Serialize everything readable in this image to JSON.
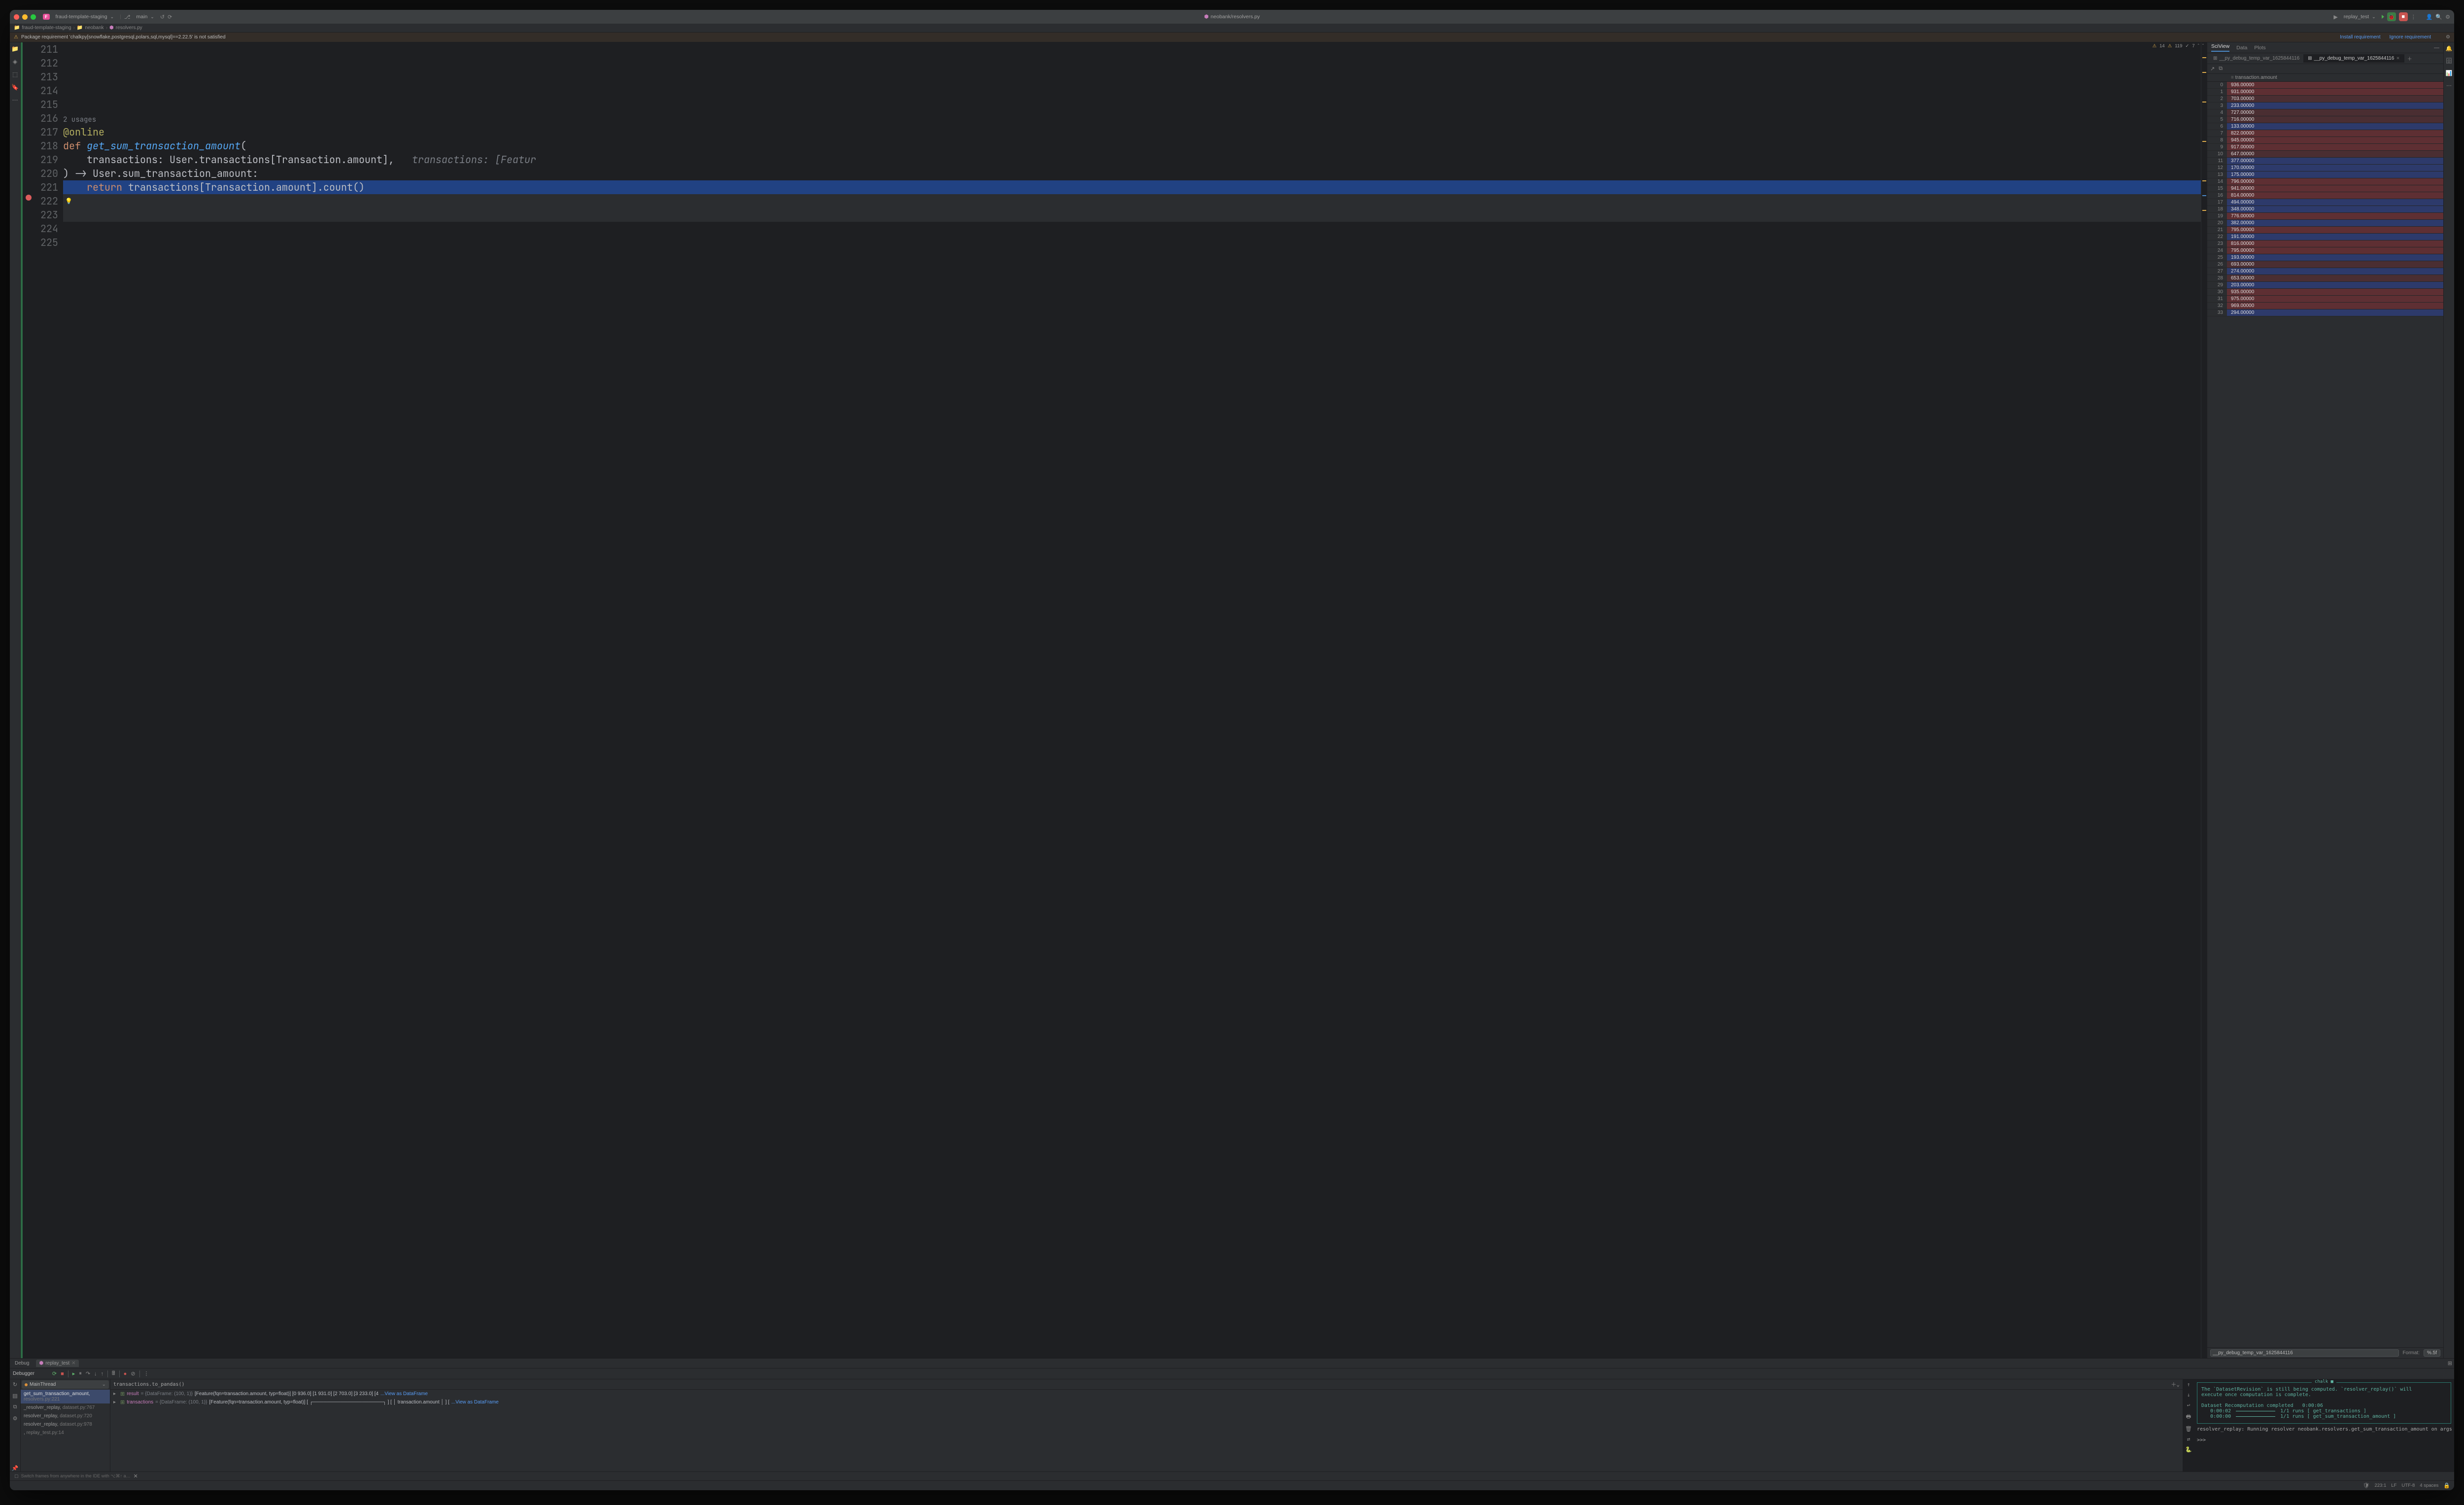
{
  "titlebar": {
    "project_badge": "F",
    "project_name": "fraud-template-staging",
    "branch": "main",
    "center_file": "neobank/resolvers.py",
    "run_config": "replay_test"
  },
  "breadcrumb": {
    "parts": [
      "fraud-template-staging",
      "neobank",
      "resolvers.py"
    ]
  },
  "warning": {
    "text": "Package requirement 'chalkpy[snowflake,postgresql,polars,sql,mysql]==2.22.5' is not satisfied",
    "install": "Install requirement",
    "ignore": "Ignore requirement"
  },
  "editor": {
    "stats": {
      "warn_a": "14",
      "warn_b": "119",
      "typo": "7"
    },
    "lines_start": 211,
    "usages": "2 usages",
    "code": {
      "l217": "@online",
      "l218_def": "def ",
      "l218_fn": "get_sum_transaction_amount",
      "l218_paren": "(",
      "l219": "    transactions: User.transactions[Transaction.amount],",
      "l219_hint": "   transactions: [Featur",
      "l220": ") -> User.sum_transaction_amount:",
      "l221_kw": "    return ",
      "l221_rest": "transactions[Transaction.amount].count()"
    },
    "breakpoint_line": 221
  },
  "sciview": {
    "tabs": [
      "SciView",
      "Data",
      "Plots"
    ],
    "subtabs": [
      "__py_debug_temp_var_1625844116",
      "__py_debug_temp_var_1625844116"
    ],
    "column": "transaction.amount",
    "rows": [
      {
        "i": 0,
        "v": "936.00000",
        "c": "red"
      },
      {
        "i": 1,
        "v": "931.00000",
        "c": "red"
      },
      {
        "i": 2,
        "v": "703.00000",
        "c": "dred"
      },
      {
        "i": 3,
        "v": "233.00000",
        "c": "blue"
      },
      {
        "i": 4,
        "v": "727.00000",
        "c": "dred"
      },
      {
        "i": 5,
        "v": "716.00000",
        "c": "dred"
      },
      {
        "i": 6,
        "v": "133.00000",
        "c": "blue"
      },
      {
        "i": 7,
        "v": "822.00000",
        "c": "red"
      },
      {
        "i": 8,
        "v": "945.00000",
        "c": "red"
      },
      {
        "i": 9,
        "v": "917.00000",
        "c": "red"
      },
      {
        "i": 10,
        "v": "647.00000",
        "c": "dred"
      },
      {
        "i": 11,
        "v": "377.00000",
        "c": "blue"
      },
      {
        "i": 12,
        "v": "170.00000",
        "c": "blue"
      },
      {
        "i": 13,
        "v": "175.00000",
        "c": "blue"
      },
      {
        "i": 14,
        "v": "796.00000",
        "c": "red"
      },
      {
        "i": 15,
        "v": "941.00000",
        "c": "red"
      },
      {
        "i": 16,
        "v": "814.00000",
        "c": "red"
      },
      {
        "i": 17,
        "v": "494.00000",
        "c": "blue"
      },
      {
        "i": 18,
        "v": "348.00000",
        "c": "blue"
      },
      {
        "i": 19,
        "v": "776.00000",
        "c": "red"
      },
      {
        "i": 20,
        "v": "382.00000",
        "c": "blue"
      },
      {
        "i": 21,
        "v": "795.00000",
        "c": "red"
      },
      {
        "i": 22,
        "v": "191.00000",
        "c": "blue"
      },
      {
        "i": 23,
        "v": "816.00000",
        "c": "red"
      },
      {
        "i": 24,
        "v": "795.00000",
        "c": "red"
      },
      {
        "i": 25,
        "v": "193.00000",
        "c": "blue"
      },
      {
        "i": 26,
        "v": "693.00000",
        "c": "dred"
      },
      {
        "i": 27,
        "v": "274.00000",
        "c": "blue"
      },
      {
        "i": 28,
        "v": "653.00000",
        "c": "dred"
      },
      {
        "i": 29,
        "v": "203.00000",
        "c": "blue"
      },
      {
        "i": 30,
        "v": "935.00000",
        "c": "red"
      },
      {
        "i": 31,
        "v": "975.00000",
        "c": "red"
      },
      {
        "i": 32,
        "v": "969.00000",
        "c": "red"
      },
      {
        "i": 33,
        "v": "294.00000",
        "c": "blue"
      }
    ],
    "footer_input": "__py_debug_temp_var_1625844116",
    "format_label": "Format:",
    "format_value": "%.5f"
  },
  "debug": {
    "tab_main": "Debug",
    "tab_config": "replay_test",
    "debugger_label": "Debugger",
    "thread": "MainThread",
    "frames": [
      {
        "fn": "get_sum_transaction_amount",
        "loc": "resolvers.py:221"
      },
      {
        "fn": "_resolver_replay",
        "loc": "dataset.py:767"
      },
      {
        "fn": "resolver_replay",
        "loc": "dataset.py:720"
      },
      {
        "fn": "resolver_replay",
        "loc": "dataset.py:978"
      },
      {
        "fn": "<module>",
        "loc": "replay_test.py:14"
      }
    ],
    "eval_expr": "transactions.to_pandas()",
    "vars": [
      {
        "name": "result",
        "type": "{DataFrame: (100, 1)}",
        "value": "[Feature(fqn=transaction.amount, typ=float)] [0          936.0] [1          931.0] [2          703.0] [3          233.0] [4 ",
        "link": "...View as DataFrame"
      },
      {
        "name": "transactions",
        "type": "{DataFrame: (100, 1)}",
        "value": "[Feature(fqn=transaction.amount, typ=float)] [ ┌────────────────────┐ ] [ │ transaction.amount │ ] [ ",
        "link": "...View as DataFrame"
      }
    ],
    "console": {
      "title": "chalk ■",
      "msg": "The `DatasetRevision` is still being computed. `resolver_replay()` will\nexecute once computation is complete.",
      "complete": "Dataset Recomputation completed   0:00:06",
      "row1_time": "0:00:02",
      "row1_right": "1/1 runs [ get_transactions ]",
      "row2_time": "0:00:00",
      "row2_right": "1/1 runs [ get_sum_transaction_amount ]",
      "after": "resolver_replay: Running resolver neobank.resolvers.get_sum_transaction_amount on args ([{'transaction.amount': 9",
      "prompt": ">>>"
    },
    "hint": "Switch frames from anywhere in the IDE with ⌥⌘↑ a…"
  },
  "statusbar": {
    "pos": "223:1",
    "sep": "LF",
    "enc": "UTF-8",
    "indent": "4 spaces"
  }
}
